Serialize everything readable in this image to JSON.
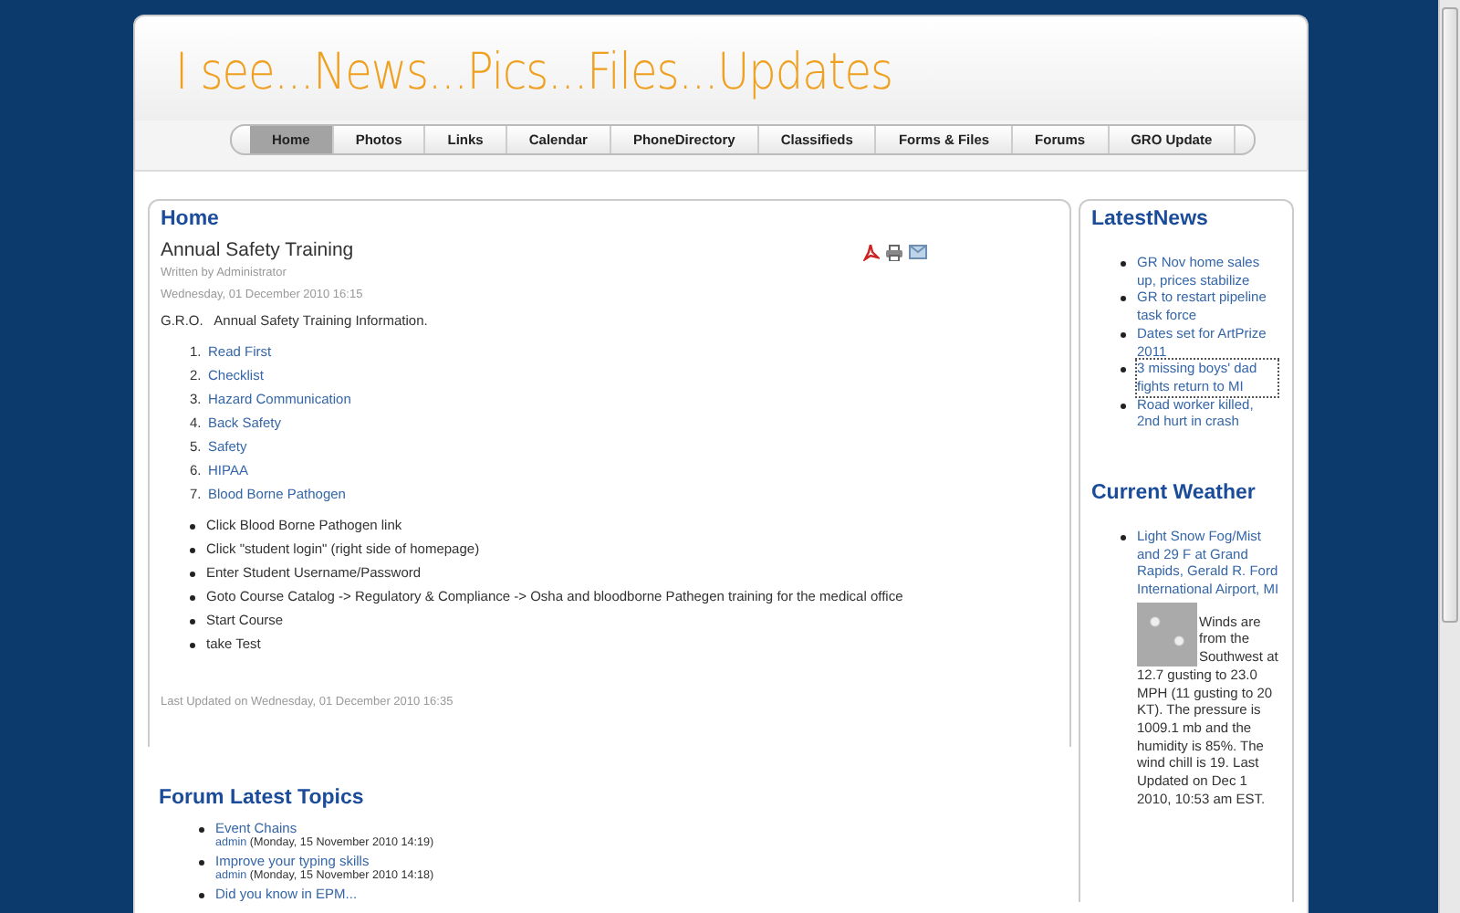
{
  "site_title": "I see...News...Pics...Files...Updates",
  "menu": [
    {
      "label": "Home",
      "selected": true
    },
    {
      "label": "Photos",
      "selected": false
    },
    {
      "label": "Links",
      "selected": false
    },
    {
      "label": "Calendar",
      "selected": false
    },
    {
      "label": "PhoneDirectory",
      "selected": false
    },
    {
      "label": "Classifieds",
      "selected": false
    },
    {
      "label": "Forms & Files",
      "selected": false
    },
    {
      "label": "Forums",
      "selected": false
    },
    {
      "label": "GRO Update",
      "selected": false
    }
  ],
  "main": {
    "heading": "Home",
    "article": {
      "title": "Annual Safety Training",
      "author": "Written by Administrator",
      "date": "Wednesday, 01 December 2010 16:15",
      "intro": "G.R.O.   Annual Safety Training Information.",
      "links": [
        {
          "number": "1.",
          "label": "Read First"
        },
        {
          "number": "2.",
          "label": "Checklist"
        },
        {
          "number": "3.",
          "label": "Hazard Communication"
        },
        {
          "number": "4.",
          "label": "Back Safety"
        },
        {
          "number": "5.",
          "label": "Safety"
        },
        {
          "number": "6.",
          "label": "HIPAA"
        },
        {
          "number": "7.",
          "label": "Blood Borne Pathogen"
        }
      ],
      "steps": [
        "Click Blood Borne Pathogen link",
        "Click \"student login\" (right side of homepage)",
        "Enter Student Username/Password",
        "Goto Course Catalog -> Regulatory & Compliance -> Osha and bloodborne Pathegen training for the medical office",
        "Start Course",
        "take Test"
      ],
      "last_updated": "Last Updated on Wednesday, 01 December 2010 16:35"
    },
    "forum": {
      "heading": "Forum Latest Topics",
      "topics": [
        {
          "title": "Event Chains",
          "author": "admin",
          "date": "(Monday, 15 November 2010 14:19)"
        },
        {
          "title": "Improve your typing skills",
          "author": "admin",
          "date": "(Monday, 15 November 2010 14:18)"
        },
        {
          "title": "Did you know in EPM..."
        }
      ]
    }
  },
  "sidebar": {
    "news_heading": "LatestNews",
    "news": [
      {
        "title": "GR Nov home sales up, prices stabilize",
        "focused": false
      },
      {
        "title": "GR to restart pipeline task force",
        "focused": false
      },
      {
        "title": "Dates set for ArtPrize 2011",
        "focused": false
      },
      {
        "title": "3 missing boys' dad fights return to MI",
        "focused": true
      },
      {
        "title": "Road worker killed, 2nd hurt in crash",
        "focused": false
      }
    ],
    "weather_heading": "Current Weather",
    "weather": {
      "condition": "Light Snow Fog/Mist and 29 F at Grand Rapids, Gerald R. Ford International Airport, MI",
      "details_beside_image": "Winds are from the Southwest at",
      "details": "12.7 gusting to 23.0 MPH (11 gusting to 20 KT). The pressure is 1009.1 mb and the humidity is 85%. The wind chill is 19. Last Updated on Dec 1 2010, 10:53 am EST."
    }
  }
}
